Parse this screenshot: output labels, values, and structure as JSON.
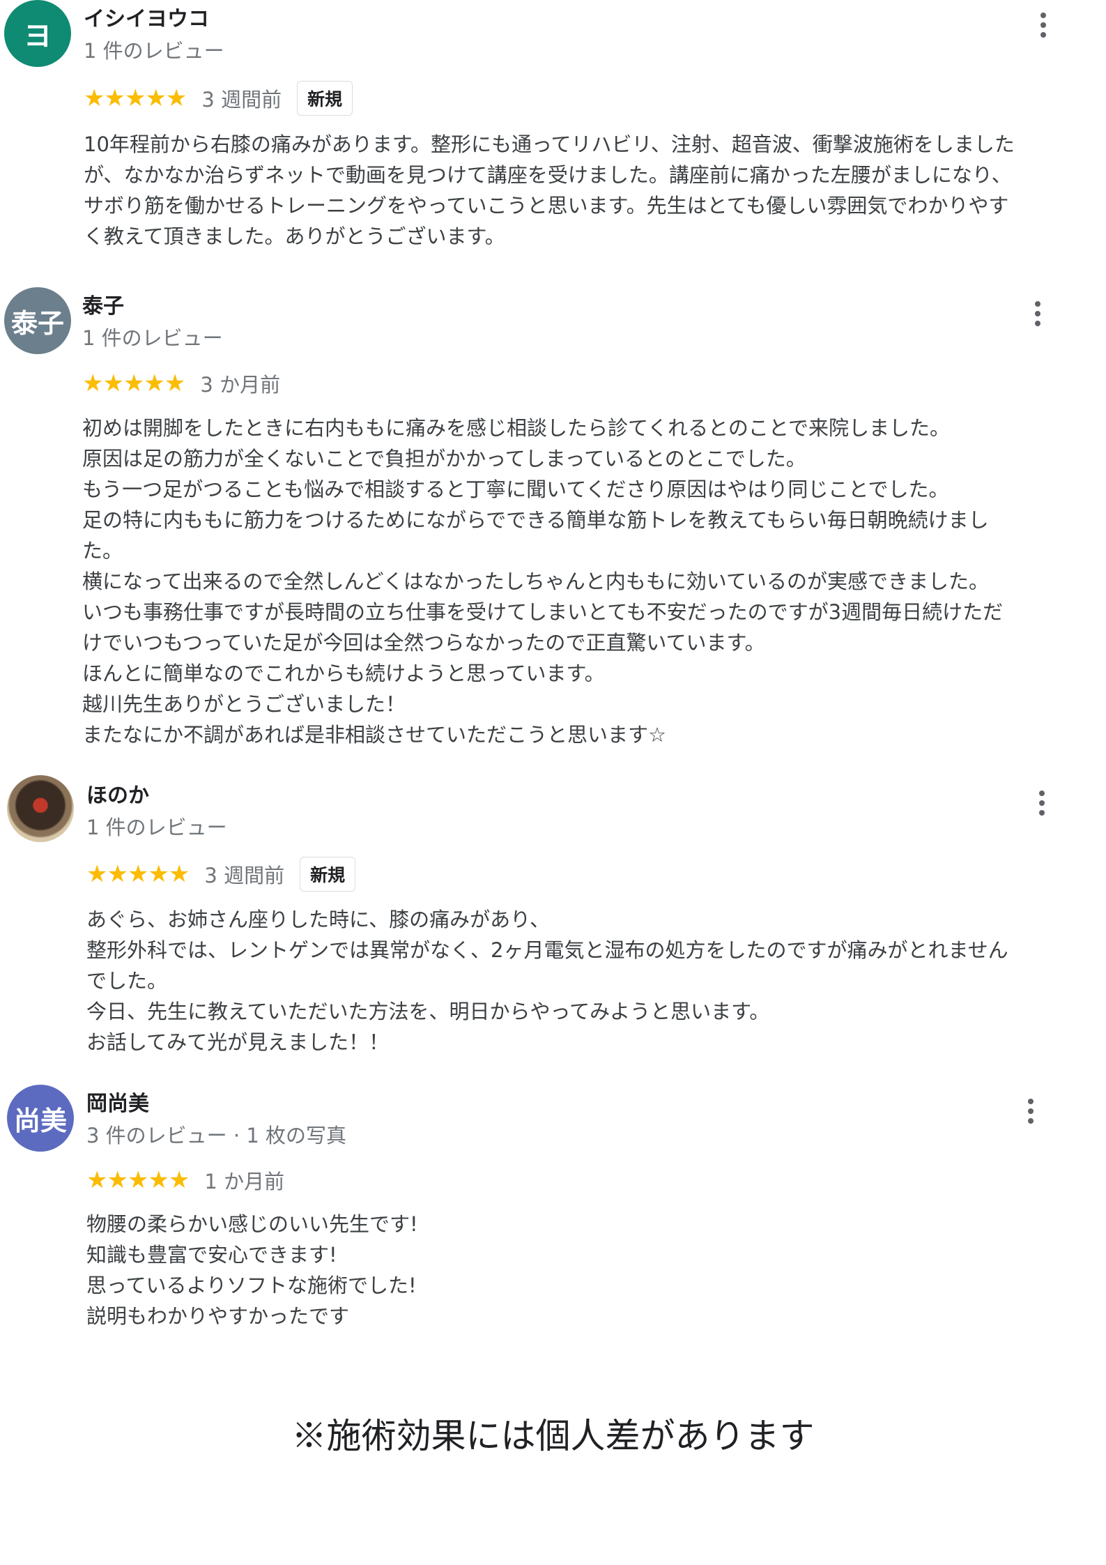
{
  "reviews": [
    {
      "name": "イシイヨウコ",
      "avatar_text": "ヨ",
      "avatar_color": "#0f8a73",
      "meta": "1 件のレビュー",
      "stars": "★★★★★",
      "rating": 5,
      "when": "3 週間前",
      "badge": "新規",
      "lines": [
        "10年程前から右膝の痛みがあります。整形にも通ってリハビリ、注射、超音波、衝撃波施術をしました",
        "が、なかなか治らずネットで動画を見つけて講座を受けました。講座前に痛かった左腰がましになり、",
        "サボり筋を働かせるトレーニングをやっていこうと思います。先生はとても優しい雰囲気でわかりやす",
        "く教えて頂きました。ありがとうございます。"
      ]
    },
    {
      "name": "泰子",
      "avatar_text": "泰子",
      "avatar_color": "#6b7f8c",
      "meta": "1 件のレビュー",
      "stars": "★★★★★",
      "rating": 5,
      "when": "3 か月前",
      "lines": [
        "初めは開脚をしたときに右内ももに痛みを感じ相談したら診てくれるとのことで来院しました。",
        "原因は足の筋力が全くないことで負担がかかってしまっているとのとこでした。",
        "もう一つ足がつることも悩みで相談すると丁寧に聞いてくださり原因はやはり同じことでした。",
        "足の特に内ももに筋力をつけるためにながらでできる簡単な筋トレを教えてもらい毎日朝晩続けまし",
        "た。",
        "横になって出来るので全然しんどくはなかったしちゃんと内ももに効いているのが実感できました。",
        "いつも事務仕事ですが長時間の立ち仕事を受けてしまいとても不安だったのですが3週間毎日続けただ",
        "けでいつもつっていた足が今回は全然つらなかったので正直驚いています。",
        "ほんとに簡単なのでこれからも続けようと思っています。",
        "越川先生ありがとうございました！",
        "またなにか不調があれば是非相談させていただこうと思います☆"
      ]
    },
    {
      "name": "ほのか",
      "avatar_text": "",
      "avatar_color": "#5b4a3a",
      "meta": "1 件のレビュー",
      "stars": "★★★★★",
      "rating": 5,
      "when": "3 週間前",
      "badge": "新規",
      "lines": [
        "あぐら、お姉さん座りした時に、膝の痛みがあり、",
        "整形外科では、レントゲンでは異常がなく、2ヶ月電気と湿布の処方をしたのですが痛みがとれません",
        "でした。",
        "今日、先生に教えていただいた方法を、明日からやってみようと思います。",
        "お話してみて光が見えました！！"
      ]
    },
    {
      "name": "岡尚美",
      "avatar_text": "尚美",
      "avatar_color": "#5c6bc0",
      "meta": "3 件のレビュー · 1 枚の写真",
      "stars": "★★★★★",
      "rating": 5,
      "when": "1 か月前",
      "lines": [
        "物腰の柔らかい感じのいい先生です!",
        "知識も豊富で安心できます!",
        "思っているよりソフトな施術でした!",
        "説明もわかりやすかったです"
      ]
    }
  ],
  "footer_note": "※施術効果には個人差があります"
}
